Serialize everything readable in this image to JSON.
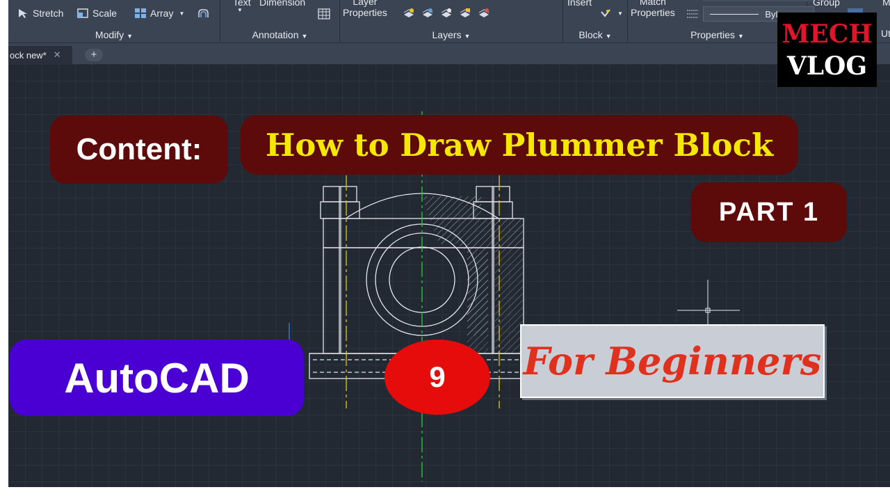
{
  "ribbon": {
    "modify": {
      "stretch_label": "Stretch",
      "scale_label": "Scale",
      "array_label": "Array",
      "title": "Modify"
    },
    "annotation": {
      "text_label": "Text",
      "dimension_label": "Dimension",
      "title": "Annotation"
    },
    "layers": {
      "layer_label_line1": "Layer",
      "layer_label_line2": "Properties",
      "title": "Layers"
    },
    "block": {
      "insert_label": "Insert",
      "title": "Block"
    },
    "properties": {
      "match_line1": "Match",
      "match_line2": "Properties",
      "bylayer_value": "ByLayer",
      "title": "Properties"
    },
    "groups": {
      "group_label": "Group",
      "utilities_label": "Ut",
      "measure_label": "Me"
    }
  },
  "tabs": {
    "active_tab_label": "ock new*",
    "close_glyph": "✕",
    "add_glyph": "+"
  },
  "overlay": {
    "content_label": "Content:",
    "title": "How to Draw Plummer Block",
    "part_label": "PART 1",
    "software_label": "AutoCAD",
    "episode_number": "9",
    "audience_label": "For Beginners"
  },
  "logo": {
    "line1": "MECH",
    "line2": "VLOG"
  },
  "colors": {
    "ribbon_bg": "#3b4453",
    "canvas_bg": "#222933",
    "badge_maroon": "#5c0a0a",
    "title_yellow": "#f5e800",
    "autocad_purple": "#4a00d2",
    "episode_red": "#e60c0c",
    "beginners_orange": "#e0301e",
    "centerline_green": "#2ecc40",
    "centerline_yellow": "#e6c800"
  }
}
